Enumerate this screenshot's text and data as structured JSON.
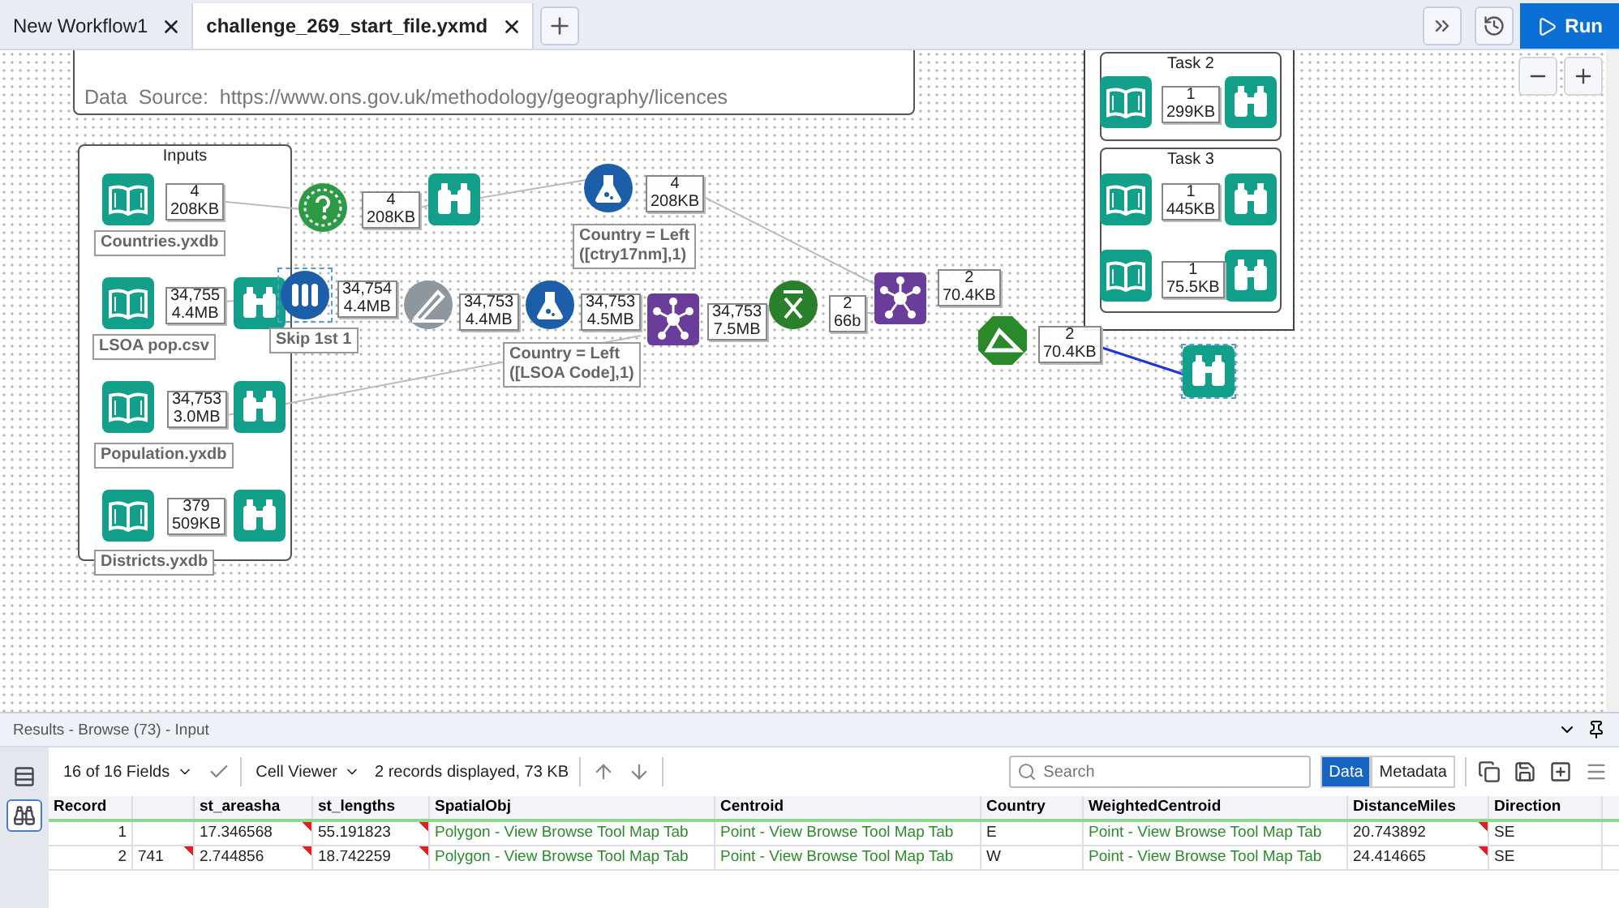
{
  "tabs": [
    {
      "label": "New Workflow1",
      "selected": false
    },
    {
      "label": "challenge_269_start_file.yxmd",
      "selected": true
    }
  ],
  "run_button": {
    "label": "Run"
  },
  "canvas": {
    "comment": "Data  Source:  https://www.ons.gov.uk/methodology/geography/licences",
    "containers": [
      {
        "title": "Inputs"
      },
      {
        "title": "Task 2"
      },
      {
        "title": "Task 3"
      }
    ],
    "tools": [
      {
        "kind": "input",
        "selected": false
      },
      {
        "kind": "test",
        "selected": false
      },
      {
        "kind": "browse",
        "selected": false
      },
      {
        "kind": "formula",
        "selected": false
      },
      {
        "kind": "input",
        "selected": false
      },
      {
        "kind": "browse",
        "selected": false
      },
      {
        "kind": "sample",
        "selected": true
      },
      {
        "kind": "select",
        "selected": false
      },
      {
        "kind": "formula",
        "selected": false
      },
      {
        "kind": "join",
        "selected": false
      },
      {
        "kind": "summarize",
        "selected": false
      },
      {
        "kind": "join",
        "selected": false
      },
      {
        "kind": "distance",
        "selected": false
      },
      {
        "kind": "browse",
        "selected": true
      },
      {
        "kind": "input",
        "selected": false
      },
      {
        "kind": "browse",
        "selected": false
      },
      {
        "kind": "input",
        "selected": false
      },
      {
        "kind": "browse",
        "selected": false
      },
      {
        "kind": "input",
        "selected": false
      },
      {
        "kind": "browse",
        "selected": false
      },
      {
        "kind": "input",
        "selected": false
      },
      {
        "kind": "browse",
        "selected": false
      },
      {
        "kind": "input",
        "selected": false
      },
      {
        "kind": "browse",
        "selected": false
      }
    ],
    "record_counts": [
      {
        "count": "4",
        "size": "208KB"
      },
      {
        "count": "4",
        "size": "208KB"
      },
      {
        "count": "4",
        "size": "208KB"
      },
      {
        "count": "34,755",
        "size": "4.4MB"
      },
      {
        "count": "34,754",
        "size": "4.4MB"
      },
      {
        "count": "34,753",
        "size": "4.4MB"
      },
      {
        "count": "34,753",
        "size": "4.5MB"
      },
      {
        "count": "34,753",
        "size": "7.5MB"
      },
      {
        "count": "2",
        "size": "66b"
      },
      {
        "count": "2",
        "size": "70.4KB"
      },
      {
        "count": "2",
        "size": "70.4KB"
      },
      {
        "count": "34,753",
        "size": "3.0MB"
      },
      {
        "count": "379",
        "size": "509KB"
      },
      {
        "count": "1",
        "size": "299KB"
      },
      {
        "count": "1",
        "size": "445KB"
      },
      {
        "count": "1",
        "size": "75.5KB"
      }
    ],
    "annotations": [
      "Countries.yxdb",
      "Country = Left\n([ctry17nm],1)",
      "LSOA pop.csv",
      "Skip 1st 1",
      "Country = Left\n([LSOA Code],1)",
      "Population.yxdb",
      "Districts.yxdb"
    ]
  },
  "results": {
    "title": "Results - Browse (73) - Input",
    "side_tabs": [
      {
        "kind": "list",
        "selected": false
      },
      {
        "kind": "browse",
        "selected": true
      }
    ],
    "fields": "16 of 16 Fields",
    "viewer": "Cell Viewer",
    "status": "2 records displayed, 73 KB",
    "search": {
      "placeholder": "Search"
    },
    "view_tabs": [
      {
        "label": "Data",
        "selected": true
      },
      {
        "label": "Metadata",
        "selected": false
      }
    ],
    "table": {
      "columns": [
        {
          "label": "Record",
          "kind": "record"
        },
        {
          "kind": "blank"
        },
        {
          "label": "st_areasha",
          "kind": "text"
        },
        {
          "label": "st_lengths",
          "kind": "text"
        },
        {
          "label": "SpatialObj",
          "kind": "spatial"
        },
        {
          "label": "Centroid",
          "kind": "spatial"
        },
        {
          "label": "Country",
          "kind": "text"
        },
        {
          "label": "WeightedCentroid",
          "kind": "spatial"
        },
        {
          "label": "DistanceMiles",
          "kind": "text"
        },
        {
          "label": "Direction",
          "kind": "text"
        }
      ],
      "rows": [
        {
          "cells": [
            {
              "text": "1",
              "flag": false
            },
            {
              "flag": false
            },
            {
              "text": "17.346568",
              "flag": true
            },
            {
              "text": "55.191823",
              "flag": true
            },
            {
              "text": "Polygon - View Browse Tool Map Tab",
              "flag": false
            },
            {
              "text": "Point - View Browse Tool Map Tab",
              "flag": false
            },
            {
              "text": "E",
              "flag": false
            },
            {
              "text": "Point - View Browse Tool Map Tab",
              "flag": false
            },
            {
              "text": "20.743892",
              "flag": true
            },
            {
              "text": "SE",
              "flag": false
            }
          ]
        },
        {
          "cells": [
            {
              "text": "2",
              "flag": false
            },
            {
              "text": "741",
              "flag": true
            },
            {
              "text": "2.744856",
              "flag": true
            },
            {
              "text": "18.742259",
              "flag": true
            },
            {
              "text": "Polygon - View Browse Tool Map Tab",
              "flag": false
            },
            {
              "text": "Point - View Browse Tool Map Tab",
              "flag": false
            },
            {
              "text": "W",
              "flag": false
            },
            {
              "text": "Point - View Browse Tool Map Tab",
              "flag": false
            },
            {
              "text": "24.414665",
              "flag": true
            },
            {
              "text": "SE",
              "flag": false
            }
          ]
        }
      ]
    }
  }
}
